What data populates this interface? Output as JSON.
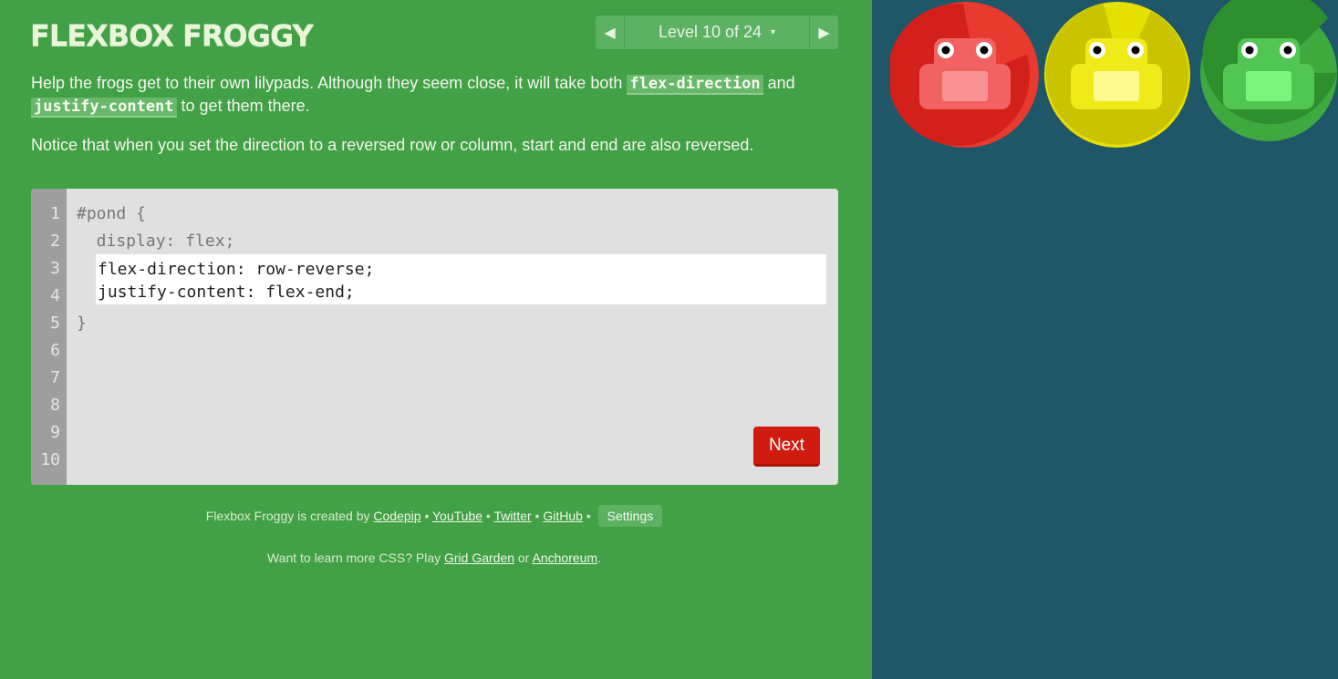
{
  "app": {
    "title": "FLEXBOX FROGGY"
  },
  "level_nav": {
    "prev_icon": "triangle-left-icon",
    "label": "Level 10 of 24",
    "caret": "▾",
    "next_icon": "triangle-right-icon"
  },
  "instructions": {
    "p1_before": "Help the frogs get to their own lilypads. Although they seem close, it will take both ",
    "p1_code1": "flex-direction",
    "p1_mid": " and",
    "p1_code2": "justify-content",
    "p1_after": " to get them there.",
    "p2": "Notice that when you set the direction to a reversed row or column, start and end are also reversed."
  },
  "editor": {
    "line_numbers": [
      "1",
      "2",
      "3",
      "4",
      "5",
      "6",
      "7",
      "8",
      "9",
      "10"
    ],
    "line1": "#pond {",
    "line2": "  display: flex;",
    "line5": "}",
    "input_value": "flex-direction: row-reverse;\njustify-content: flex-end;",
    "next_label": "Next"
  },
  "footer": {
    "credits_prefix": "Flexbox Froggy is created by ",
    "codepip": "Codepip",
    "sep": " • ",
    "youtube": "YouTube",
    "twitter": "Twitter",
    "github": "GitHub",
    "settings": "Settings",
    "more_prefix": "Want to learn more CSS? Play ",
    "grid_garden": "Grid Garden",
    "or": " or ",
    "anchoreum": "Anchoreum",
    "period": "."
  },
  "pond": {
    "frogs": [
      {
        "color": "red",
        "pad_color": "#d4201b",
        "pad_dark": "#e83a2e",
        "body_color": "#f16363",
        "belly_color": "#f99393"
      },
      {
        "color": "yellow",
        "pad_color": "#c9c300",
        "pad_dark": "#e6e000",
        "body_color": "#f0ea1a",
        "belly_color": "#fdfb90"
      },
      {
        "color": "green",
        "pad_color": "#2e8f2e",
        "pad_dark": "#3ea93e",
        "body_color": "#52c652",
        "belly_color": "#7df57d"
      }
    ]
  }
}
